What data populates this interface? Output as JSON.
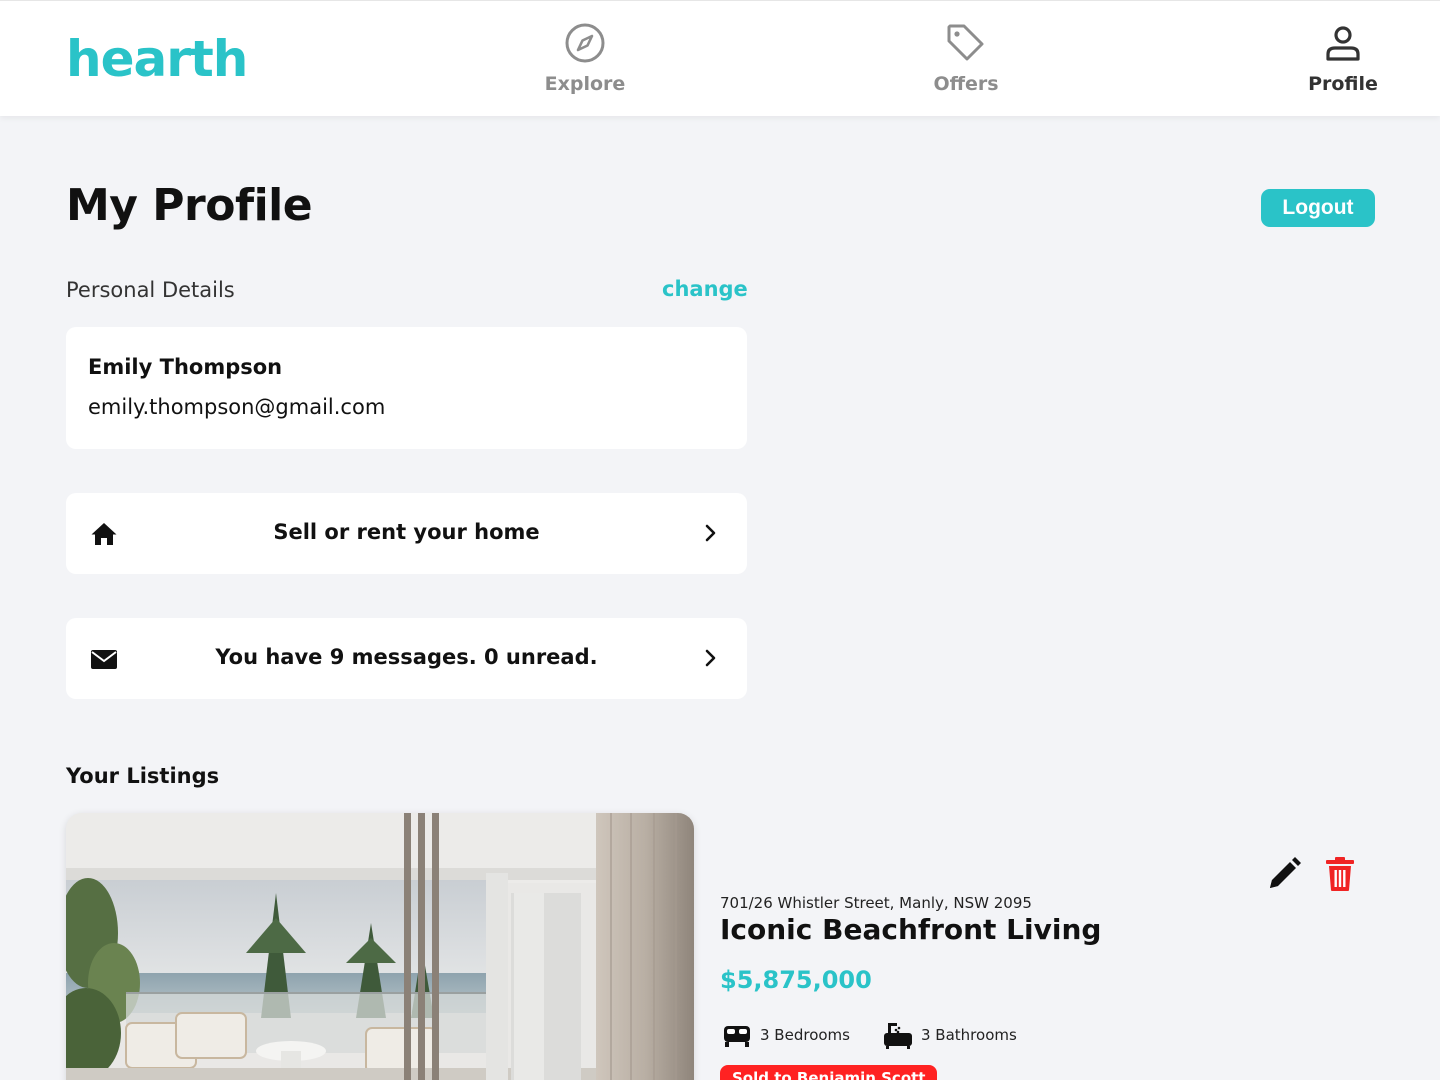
{
  "brand": {
    "name": "hearth",
    "color": "#2ac3c8"
  },
  "nav": {
    "items": [
      {
        "label": "Explore",
        "icon": "compass-icon"
      },
      {
        "label": "Offers",
        "icon": "tag-icon"
      },
      {
        "label": "Profile",
        "icon": "user-icon",
        "active": true
      }
    ]
  },
  "page": {
    "title": "My Profile",
    "logout_label": "Logout"
  },
  "personal_details": {
    "section_label": "Personal Details",
    "change_label": "change",
    "name": "Emily Thompson",
    "email": "emily.thompson@gmail.com"
  },
  "actions": {
    "sell": {
      "label": "Sell or rent your home",
      "icon": "home-icon"
    },
    "messages": {
      "label": "You have 9 messages. 0 unread.",
      "icon": "envelope-icon"
    }
  },
  "listings": {
    "section_label": "Your Listings",
    "items": [
      {
        "address": "701/26 Whistler Street, Manly, NSW 2095",
        "title": "Iconic Beachfront Living",
        "price": "$5,875,000",
        "bedrooms": "3 Bedrooms",
        "bathrooms": "3 Bathrooms",
        "status": "Sold to Benjamin Scott",
        "status_color": "#ff2222"
      }
    ]
  }
}
